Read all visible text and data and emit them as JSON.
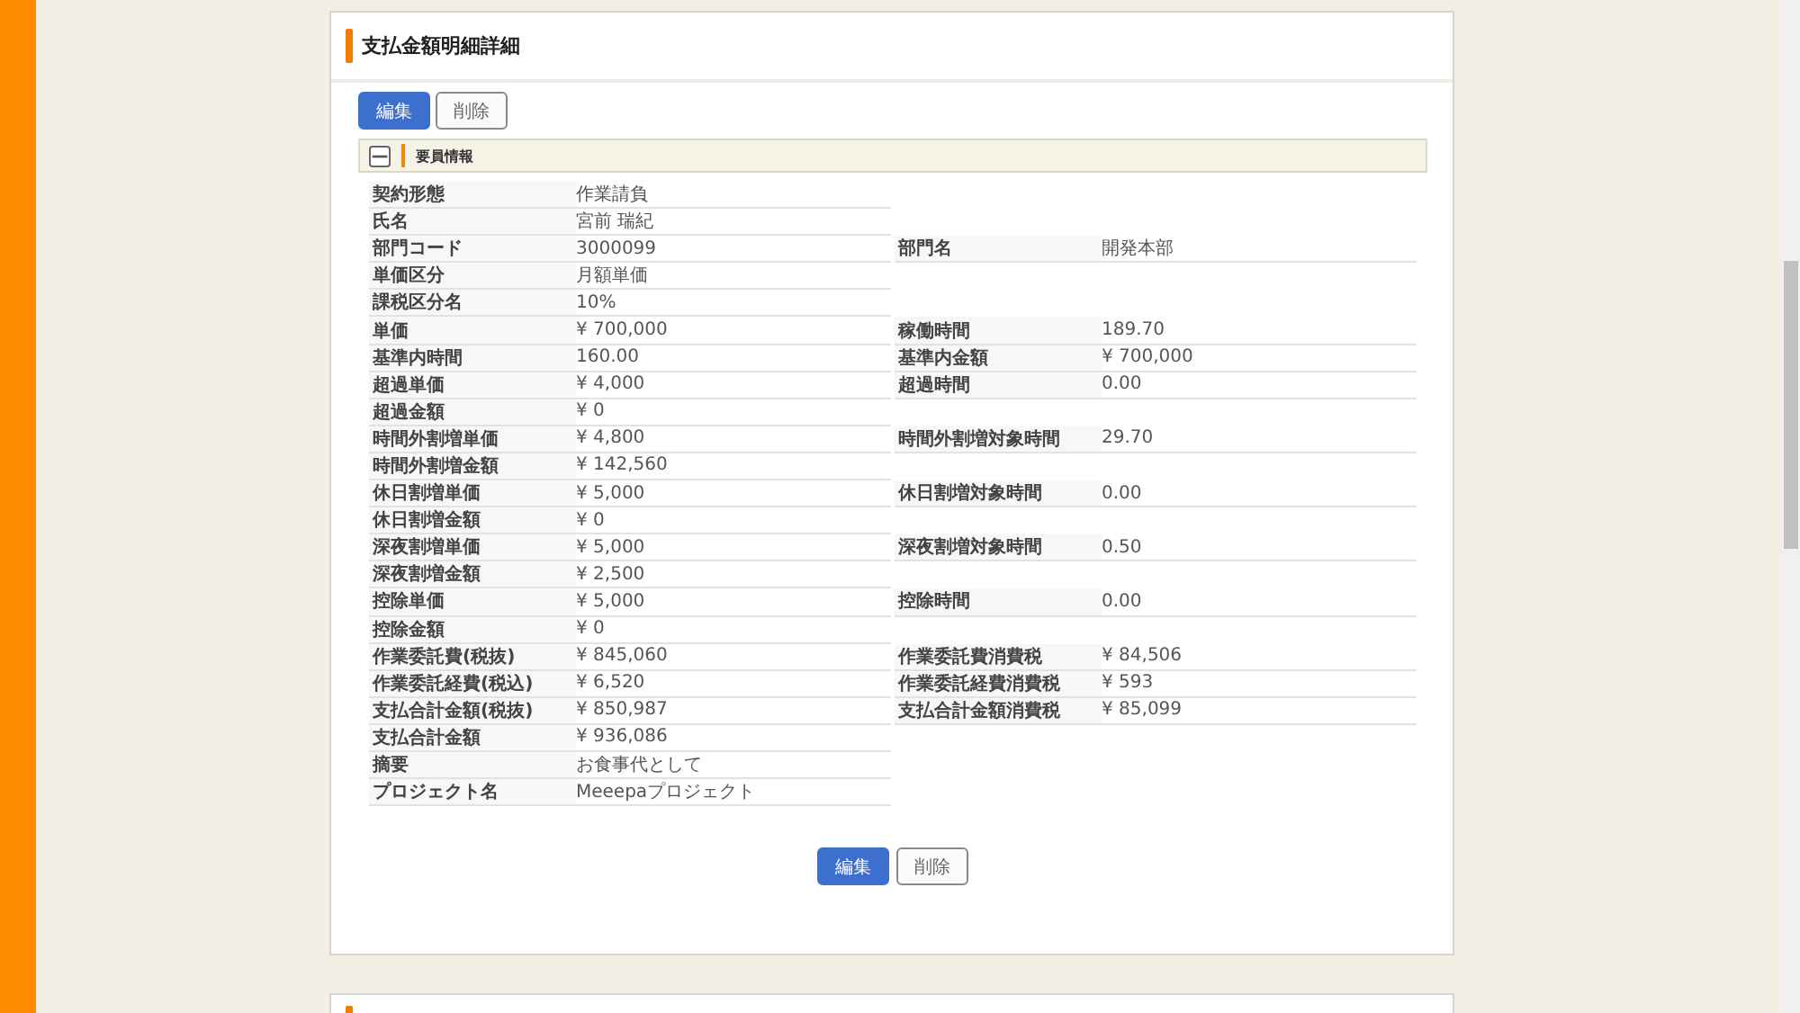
{
  "page_title": "支払金額明細詳細",
  "top_buttons": [
    {
      "label": "編集",
      "kind": "primary"
    },
    {
      "label": "削除",
      "kind": "secondary"
    }
  ],
  "section": {
    "title": "要員情報",
    "expanded": true
  },
  "rows": [
    {
      "label": "契約形態",
      "value": "作業請負"
    },
    {
      "label": "氏名",
      "value": "宮前 瑞紀"
    },
    {
      "label": "部門コード",
      "value": "3000099",
      "right_label": "部門名",
      "right_value": "開発本部"
    },
    {
      "label": "単価区分",
      "value": "月額単価"
    },
    {
      "label": "課税区分名",
      "value": "10%"
    },
    {
      "label": "単価",
      "value": "¥ 700,000",
      "right_label": "稼働時間",
      "right_value": "189.70"
    },
    {
      "label": "基準内時間",
      "value": "160.00",
      "right_label": "基準内金額",
      "right_value": "¥ 700,000"
    },
    {
      "label": "超過単価",
      "value": "¥ 4,000",
      "right_label": "超過時間",
      "right_value": "0.00"
    },
    {
      "label": "超過金額",
      "value": "¥ 0"
    },
    {
      "label": "時間外割増単価",
      "value": "¥ 4,800",
      "right_label": "時間外割増対象時間",
      "right_value": "29.70"
    },
    {
      "label": "時間外割増金額",
      "value": "¥ 142,560"
    },
    {
      "label": "休日割増単価",
      "value": "¥ 5,000",
      "right_label": "休日割増対象時間",
      "right_value": "0.00"
    },
    {
      "label": "休日割増金額",
      "value": "¥ 0"
    },
    {
      "label": "深夜割増単価",
      "value": "¥ 5,000",
      "right_label": "深夜割増対象時間",
      "right_value": "0.50"
    },
    {
      "label": "深夜割増金額",
      "value": "¥ 2,500"
    },
    {
      "label": "控除単価",
      "value": "¥ 5,000",
      "right_label": "控除時間",
      "right_value": "0.00"
    },
    {
      "label": "控除金額",
      "value": "¥ 0"
    },
    {
      "label": "作業委託費(税抜)",
      "value": "¥ 845,060",
      "right_label": "作業委託費消費税",
      "right_value": "¥ 84,506"
    },
    {
      "label": "作業委託経費(税込)",
      "value": "¥ 6,520",
      "right_label": "作業委託経費消費税",
      "right_value": "¥ 593"
    },
    {
      "label": "支払合計金額(税抜)",
      "value": "¥ 850,987",
      "right_label": "支払合計金額消費税",
      "right_value": "¥ 85,099"
    },
    {
      "label": "支払合計金額",
      "value": "¥ 936,086"
    },
    {
      "label": "摘要",
      "value": "お食事代として"
    },
    {
      "label": "プロジェクト名",
      "value": "Meeepaプロジェクト"
    }
  ],
  "bottom_buttons": [
    {
      "label": "編集",
      "kind": "primary"
    },
    {
      "label": "削除",
      "kind": "secondary"
    }
  ]
}
